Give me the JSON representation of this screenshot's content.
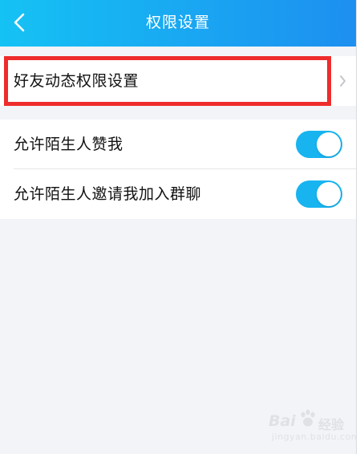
{
  "header": {
    "back_icon": "chevron-left-icon",
    "title": "权限设置",
    "gradient_start": "#15c2f4",
    "gradient_end": "#1d8ff0"
  },
  "sections": {
    "friend_feed": {
      "label": "好友动态权限设置",
      "icon": "chevron-right-icon",
      "highlight_color": "#ee2c2c"
    },
    "toggles": [
      {
        "label": "允许陌生人赞我",
        "enabled": true
      },
      {
        "label": "允许陌生人邀请我加入群聊",
        "enabled": true
      }
    ]
  },
  "toggle_color": "#17b4f0",
  "watermark": {
    "logo": "Bai",
    "text": "经验",
    "url": "jingyan.baidu.com"
  }
}
